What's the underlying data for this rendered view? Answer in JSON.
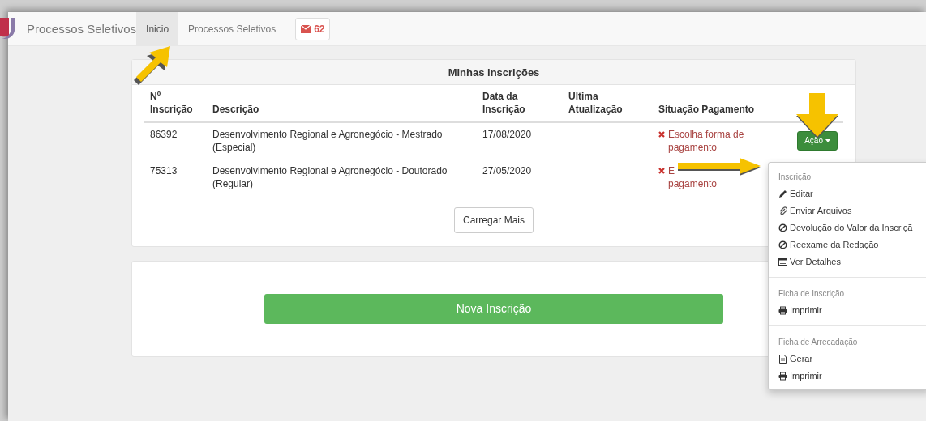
{
  "navbar": {
    "brand": "Processos Seletivos",
    "tabs": [
      {
        "label": "Inicio",
        "selected": true
      },
      {
        "label": "Processos Seletivos",
        "selected": false
      }
    ],
    "mail_count": "62"
  },
  "registrations": {
    "title": "Minhas inscrições",
    "columns": [
      "Nº Inscrição",
      "Descrição",
      "Data da Inscrição",
      "Ultima Atualização",
      "Situação Pagamento"
    ],
    "rows": [
      {
        "number": "86392",
        "description": "Desenvolvimento Regional e Agronegócio - Mestrado (Especial)",
        "date": "17/08/2020",
        "status_lines": [
          "Escolha forma de",
          "pagamento"
        ],
        "action": "Ação"
      },
      {
        "number": "75313",
        "description": "Desenvolvimento Regional e Agronegócio - Doutorado (Regular)",
        "date": "27/05/2020",
        "status_lines": [
          "E",
          "pagamento"
        ]
      }
    ],
    "load_more": "Carregar Mais"
  },
  "new_registration": "Nova Inscrição",
  "action_menu": {
    "sections": [
      {
        "header": "Inscrição",
        "items": [
          {
            "kind": "edit",
            "label": "Editar"
          },
          {
            "kind": "attach",
            "label": "Enviar Arquivos"
          },
          {
            "kind": "ban",
            "label": "Devolução do Valor da Inscriçã"
          },
          {
            "kind": "ban",
            "label": "Reexame da Redação"
          },
          {
            "kind": "details",
            "label": "Ver Detalhes"
          }
        ]
      },
      {
        "header": "Ficha de Inscrição",
        "items": [
          {
            "kind": "print",
            "label": "Imprimir"
          }
        ]
      },
      {
        "header": "Ficha de Arrecadação",
        "items": [
          {
            "kind": "file",
            "label": "Gerar"
          },
          {
            "kind": "print",
            "label": "Imprimir"
          }
        ]
      }
    ]
  }
}
